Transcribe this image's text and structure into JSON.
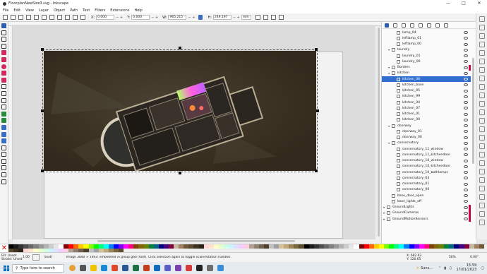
{
  "window": {
    "title": "FloorplanNewSize3.svg - Inkscape"
  },
  "menu": [
    "File",
    "Edit",
    "View",
    "Layer",
    "Object",
    "Path",
    "Text",
    "Filters",
    "Extensions",
    "Help"
  ],
  "tool_controls": {
    "x_label": "X:",
    "x_value": "0.000",
    "y_label": "Y:",
    "y_value": "0.000",
    "w_label": "W:",
    "w_value": "965.215",
    "h_label": "H:",
    "h_value": "249.197",
    "unit": "mm"
  },
  "layers": [
    {
      "label": "lamp_04",
      "depth": 2,
      "type": "object"
    },
    {
      "label": "leftlamp_01",
      "depth": 2,
      "type": "object"
    },
    {
      "label": "leftlamp_00",
      "depth": 2,
      "type": "object"
    },
    {
      "label": "laundry",
      "depth": 1,
      "type": "layer"
    },
    {
      "label": "laundry_01",
      "depth": 2,
      "type": "object"
    },
    {
      "label": "laundry_00",
      "depth": 2,
      "type": "object"
    },
    {
      "label": "Borders",
      "depth": 1,
      "type": "layer",
      "stripe": "#d2004c"
    },
    {
      "label": "kitchen",
      "depth": 1,
      "type": "layer"
    },
    {
      "label": "kitchen_08",
      "depth": 2,
      "type": "object",
      "selected": true
    },
    {
      "label": "kitchen_base",
      "depth": 2,
      "type": "object"
    },
    {
      "label": "kitchen_05",
      "depth": 2,
      "type": "object"
    },
    {
      "label": "kitchen_99",
      "depth": 2,
      "type": "object"
    },
    {
      "label": "kitchen_04",
      "depth": 2,
      "type": "object"
    },
    {
      "label": "kitchen_07",
      "depth": 2,
      "type": "object"
    },
    {
      "label": "kitchen_01",
      "depth": 2,
      "type": "object"
    },
    {
      "label": "kitchen_00",
      "depth": 2,
      "type": "object"
    },
    {
      "label": "doorway",
      "depth": 1,
      "type": "layer"
    },
    {
      "label": "doorway_01",
      "depth": 2,
      "type": "object"
    },
    {
      "label": "doorway_00",
      "depth": 2,
      "type": "object"
    },
    {
      "label": "conservatory",
      "depth": 1,
      "type": "layer"
    },
    {
      "label": "conservatory_11_window",
      "depth": 2,
      "type": "object"
    },
    {
      "label": "conservatory_11_kitchendoor",
      "depth": 2,
      "type": "object"
    },
    {
      "label": "conservatory_10_window",
      "depth": 2,
      "type": "object"
    },
    {
      "label": "conservatory_10_kitchendoor",
      "depth": 2,
      "type": "object"
    },
    {
      "label": "conservatory_10_bothlamps",
      "depth": 2,
      "type": "object"
    },
    {
      "label": "conservatory_03",
      "depth": 2,
      "type": "object"
    },
    {
      "label": "conservatory_01",
      "depth": 2,
      "type": "object"
    },
    {
      "label": "conservatory_00",
      "depth": 2,
      "type": "object"
    },
    {
      "label": "base_door_open",
      "depth": 1,
      "type": "object"
    },
    {
      "label": "base_lights_off",
      "depth": 1,
      "type": "object"
    },
    {
      "label": "GroundLights",
      "depth": 0,
      "type": "layer",
      "stripe": "#d2004c"
    },
    {
      "label": "GroundCameras",
      "depth": 0,
      "type": "layer",
      "stripe": "#d2004c"
    },
    {
      "label": "GroundMotionSensors",
      "depth": 0,
      "type": "layer",
      "stripe": "#d2004c"
    }
  ],
  "palette_colors": [
    "#000000",
    "#1a1a1a",
    "#333333",
    "#4d4d4d",
    "#666666",
    "#808080",
    "#999999",
    "#b3b3b3",
    "#cccccc",
    "#e6e6e6",
    "#ffffff",
    "#800000",
    "#ff0000",
    "#ff6600",
    "#ffcc00",
    "#ffff00",
    "#80ff00",
    "#00ff00",
    "#00ff80",
    "#00ffff",
    "#0080ff",
    "#0000ff",
    "#8000ff",
    "#ff00ff",
    "#ff0080",
    "#804000",
    "#806600",
    "#668000",
    "#008040",
    "#006680",
    "#000080",
    "#400080",
    "#800040",
    "#c8b7a0",
    "#a08060",
    "#705838",
    "#5a4a32",
    "#3f3423",
    "#2a2418",
    "#ffd5d5",
    "#ffe6cc",
    "#ffffcc",
    "#e6ffcc",
    "#ccffe6",
    "#ccf2ff",
    "#dde0ff",
    "#f2ccff",
    "#ffcce6",
    "#b0a090",
    "#908070",
    "#706050",
    "#504030",
    "#c0c0c0",
    "#a0a0a0",
    "#d4c19c",
    "#bfa77a",
    "#9b8457",
    "#7a6740",
    "#5c4c2e"
  ],
  "status": {
    "fill_label": "Fill:",
    "fill_value": "Unset",
    "stroke_label": "Stroke:",
    "stroke_value": "Unset",
    "stroke_width": "1.00",
    "layer": "(root)",
    "message": "Image 3840 × 1693: embedded in group g60 (root). Click selection again to toggle scale/rotation handles.",
    "cursor_x_label": "X:",
    "cursor_x": "682.62",
    "cursor_y_label": "Y:",
    "cursor_y": "120.65",
    "zoom": "50%",
    "rotation": "0.00°"
  },
  "taskbar": {
    "search_placeholder": "Type here to search",
    "weather": "Suns...",
    "time": "15:59",
    "date": "17/01/2023"
  },
  "colors": {
    "accent": "#2f6fcf",
    "layer_stripe": "#d2004c"
  }
}
